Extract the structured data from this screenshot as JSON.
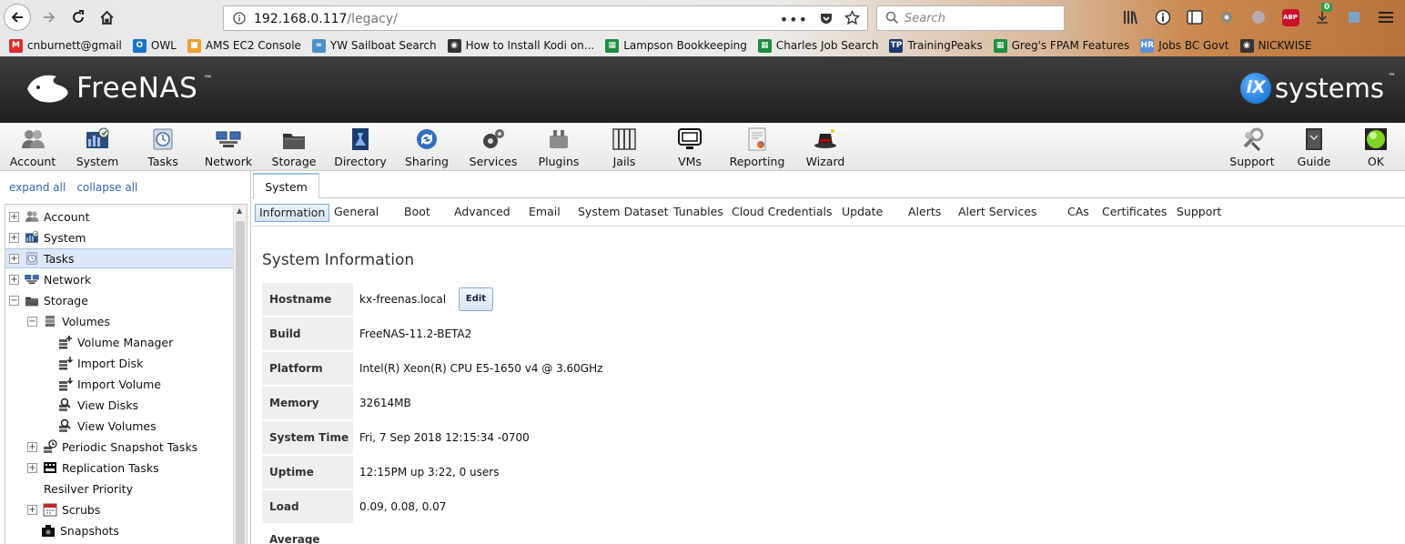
{
  "browser": {
    "url_host": "192.168.0.117",
    "url_path": "/legacy/",
    "search_placeholder": "Search",
    "downloads_badge": "0",
    "abp_label": "ABP",
    "bookmarks": [
      {
        "label": "cnburnett@gmail",
        "icon": "gmail-icon",
        "color": "#d93025",
        "glyph": "M"
      },
      {
        "label": "OWL",
        "icon": "owl-icon",
        "color": "#1a73c8",
        "glyph": "O"
      },
      {
        "label": "AMS EC2 Console",
        "icon": "aws-cube-icon",
        "color": "#f0a030",
        "glyph": "■"
      },
      {
        "label": "YW Sailboat Search",
        "icon": "wifi-icon",
        "color": "#4a90c8",
        "glyph": "≈"
      },
      {
        "label": "How to Install Kodi on...",
        "icon": "globe-icon",
        "color": "#333333",
        "glyph": "◉"
      },
      {
        "label": "Lampson Bookkeeping",
        "icon": "sheets-icon",
        "color": "#1e8e3e",
        "glyph": "▦"
      },
      {
        "label": "Charles Job Search",
        "icon": "sheets-icon",
        "color": "#1e8e3e",
        "glyph": "▦"
      },
      {
        "label": "TrainingPeaks",
        "icon": "trainingpeaks-icon",
        "color": "#1b3a6b",
        "glyph": "TP"
      },
      {
        "label": "Greg's FPAM Features",
        "icon": "sheets-icon",
        "color": "#1e8e3e",
        "glyph": "▦"
      },
      {
        "label": "Jobs BC Govt",
        "icon": "hr-icon",
        "color": "#5b8fd6",
        "glyph": "HR"
      },
      {
        "label": "NICKWISE",
        "icon": "globe-icon",
        "color": "#333333",
        "glyph": "◉"
      }
    ]
  },
  "header": {
    "brand": "FreeNAS",
    "brand_tm": "™",
    "vendor_ix": "iX",
    "vendor_rest": "systems",
    "vendor_tm": "™"
  },
  "menu": {
    "left": [
      {
        "label": "Account",
        "icon": "account-icon"
      },
      {
        "label": "System",
        "icon": "system-icon"
      },
      {
        "label": "Tasks",
        "icon": "tasks-icon"
      },
      {
        "label": "Network",
        "icon": "network-icon"
      },
      {
        "label": "Storage",
        "icon": "storage-icon"
      },
      {
        "label": "Directory",
        "icon": "directory-icon"
      },
      {
        "label": "Sharing",
        "icon": "sharing-icon"
      },
      {
        "label": "Services",
        "icon": "services-icon"
      },
      {
        "label": "Plugins",
        "icon": "plugins-icon"
      },
      {
        "label": "Jails",
        "icon": "jails-icon"
      },
      {
        "label": "VMs",
        "icon": "vms-icon"
      },
      {
        "label": "Reporting",
        "icon": "reporting-icon"
      },
      {
        "label": "Wizard",
        "icon": "wizard-icon"
      }
    ],
    "right": [
      {
        "label": "Support",
        "icon": "support-icon"
      },
      {
        "label": "Guide",
        "icon": "guide-icon"
      },
      {
        "label": "OK",
        "icon": "status-ok-icon"
      }
    ]
  },
  "tree": {
    "expand_all": "expand all",
    "collapse_all": "collapse all",
    "items": [
      {
        "label": "Account",
        "expander": "+",
        "icon": "account-icon"
      },
      {
        "label": "System",
        "expander": "+",
        "icon": "system-icon"
      },
      {
        "label": "Tasks",
        "expander": "+",
        "icon": "tasks-icon"
      },
      {
        "label": "Network",
        "expander": "+",
        "icon": "network-icon"
      },
      {
        "label": "Storage",
        "expander": "−",
        "icon": "storage-icon"
      },
      {
        "label": "Volumes",
        "expander": "−",
        "icon": "volumes-icon"
      },
      {
        "label": "Volume Manager",
        "expander": "",
        "icon": "volume-manager-icon"
      },
      {
        "label": "Import Disk",
        "expander": "",
        "icon": "import-disk-icon"
      },
      {
        "label": "Import Volume",
        "expander": "",
        "icon": "import-volume-icon"
      },
      {
        "label": "View Disks",
        "expander": "",
        "icon": "view-disks-icon"
      },
      {
        "label": "View Volumes",
        "expander": "",
        "icon": "view-volumes-icon"
      },
      {
        "label": "Periodic Snapshot Tasks",
        "expander": "+",
        "icon": "snapshot-clock-icon"
      },
      {
        "label": "Replication Tasks",
        "expander": "+",
        "icon": "replication-icon"
      },
      {
        "label": "Resilver Priority",
        "expander": "",
        "icon": ""
      },
      {
        "label": "Scrubs",
        "expander": "+",
        "icon": "calendar-icon"
      },
      {
        "label": "Snapshots",
        "expander": "",
        "icon": "camera-icon"
      }
    ]
  },
  "main": {
    "tab": "System",
    "subtabs": [
      "Information",
      "General",
      "Boot",
      "Advanced",
      "Email",
      "System Dataset",
      "Tunables",
      "Cloud Credentials",
      "Update",
      "Alerts",
      "Alert Services",
      "CAs",
      "Certificates",
      "Support"
    ],
    "active_subtab": "Information",
    "title": "System Information",
    "edit_label": "Edit",
    "rows": [
      {
        "key": "Hostname",
        "value": "kx-freenas.local"
      },
      {
        "key": "Build",
        "value": "FreeNAS-11.2-BETA2"
      },
      {
        "key": "Platform",
        "value": "Intel(R) Xeon(R) CPU E5-1650 v4 @ 3.60GHz"
      },
      {
        "key": "Memory",
        "value": "32614MB"
      },
      {
        "key": "System Time",
        "value": "Fri, 7 Sep 2018 12:15:34 -0700"
      },
      {
        "key": "Uptime",
        "value": "12:15PM up 3:22, 0 users"
      },
      {
        "key": "Load Average",
        "value": "0.09, 0.08, 0.07"
      }
    ]
  }
}
